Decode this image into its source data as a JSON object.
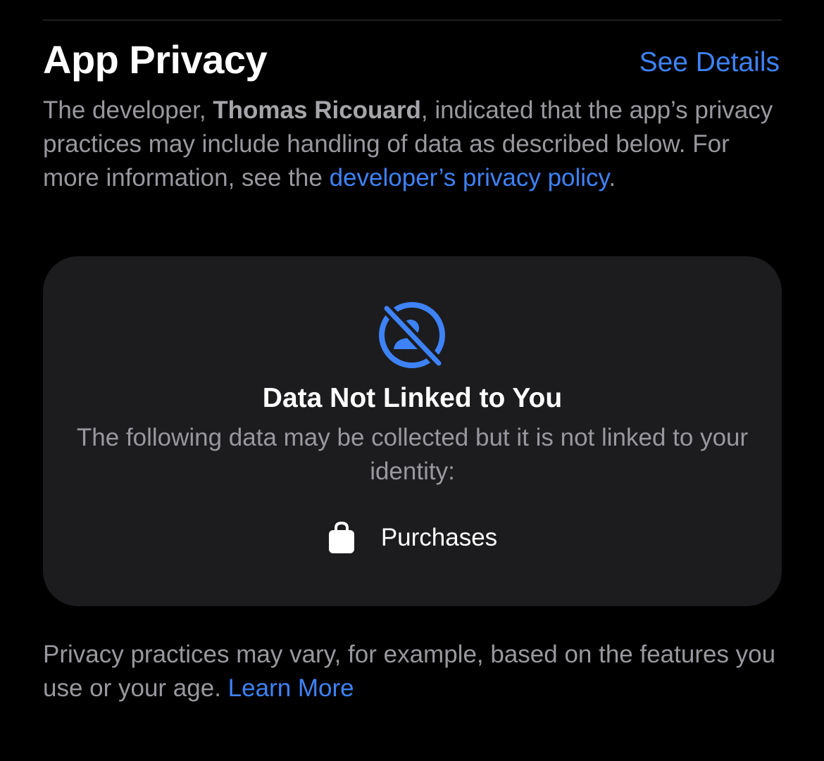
{
  "section": {
    "title": "App Privacy",
    "see_details_label": "See Details"
  },
  "intro": {
    "prefix": "The developer, ",
    "developer_name": "Thomas Ricouard",
    "middle": ", indicated that the app’s privacy practices may include handling of data as described below. For more information, see the ",
    "policy_link_label": "developer’s privacy policy",
    "suffix": "."
  },
  "card": {
    "icon": "person-crossed-circle-icon",
    "title": "Data Not Linked to You",
    "description": "The following data may be collected but it is not linked to your identity:",
    "items": [
      {
        "icon": "shopping-bag-icon",
        "label": "Purchases"
      }
    ]
  },
  "footer": {
    "text": "Privacy practices may vary, for example, based on the features you use or your age. ",
    "learn_more_label": "Learn More"
  },
  "colors": {
    "accent": "#3e82f7",
    "background": "#000000",
    "card_background": "#1c1c1e",
    "secondary_text": "#98989e"
  }
}
